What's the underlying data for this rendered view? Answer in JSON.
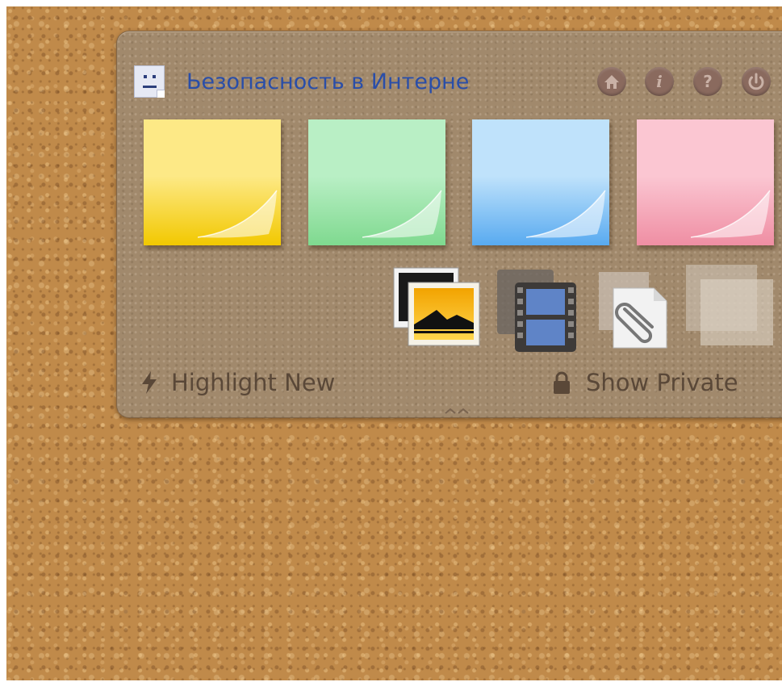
{
  "app": {
    "title": "Ьезопасность в Интерне",
    "title_color": "#2a4ea8"
  },
  "header_buttons": [
    {
      "name": "home-icon",
      "glyph": "⌂"
    },
    {
      "name": "info-icon",
      "glyph": "i"
    },
    {
      "name": "help-icon",
      "glyph": "?"
    },
    {
      "name": "power-icon",
      "glyph": "⏻"
    }
  ],
  "notes": [
    {
      "name": "note-yellow",
      "top": "#fde986",
      "bottom": "#f2c800"
    },
    {
      "name": "note-green",
      "top": "#b9efc5",
      "bottom": "#7fd98f"
    },
    {
      "name": "note-blue",
      "top": "#bfe2fb",
      "bottom": "#58aaf0"
    },
    {
      "name": "note-pink",
      "top": "#fbc6d2",
      "bottom": "#ef8ea3"
    }
  ],
  "media_icons": [
    "image-icon",
    "video-icon",
    "attachment-icon",
    "blank-note-icon"
  ],
  "filters": {
    "highlight_label": "Highlight New",
    "private_label": "Show Private"
  }
}
